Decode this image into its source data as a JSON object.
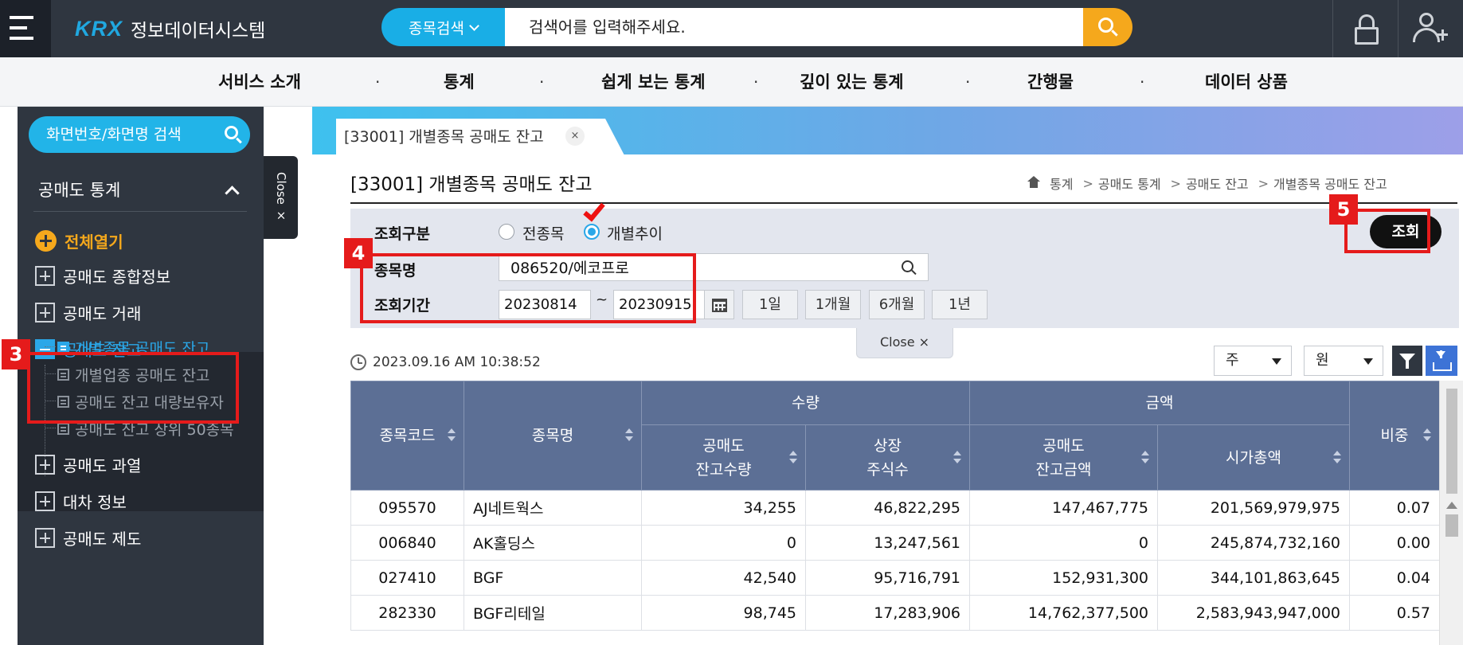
{
  "header": {
    "logo_brand": "KRX",
    "logo_name": "정보데이터시스템",
    "search_type": "종목검색",
    "search_placeholder": "검색어를 입력해주세요."
  },
  "gnb": {
    "items": [
      "서비스 소개",
      "통계",
      "쉽게 보는 통계",
      "깊이 있는 통계",
      "간행물",
      "데이터 상품"
    ],
    "separator": "·"
  },
  "sidebar": {
    "search_placeholder": "화면번호/화면명 검색",
    "category": "공매도 통계",
    "expand_all": "전체열기",
    "items": [
      {
        "label": "공매도 종합정보",
        "state": "collapsed"
      },
      {
        "label": "공매도 거래",
        "state": "collapsed"
      },
      {
        "label": "공매도 잔고",
        "state": "expanded"
      },
      {
        "label": "공매도 과열",
        "state": "collapsed"
      },
      {
        "label": "대차 정보",
        "state": "collapsed"
      },
      {
        "label": "공매도 제도",
        "state": "collapsed"
      }
    ],
    "sub_items": [
      {
        "label": "개별종목 공매도 잔고",
        "active": true
      },
      {
        "label": "개별업종 공매도 잔고",
        "active": false
      },
      {
        "label": "공매도 잔고 대량보유자",
        "active": false
      },
      {
        "label": "공매도 잔고 상위 50종목",
        "active": false
      }
    ],
    "close_label": "Close ×"
  },
  "tabs": [
    {
      "label": "[33001] 개별종목 공매도 잔고",
      "close": "×"
    }
  ],
  "page": {
    "title": "[33001] 개별종목 공매도 잔고",
    "breadcrumb": [
      "통계",
      "공매도 통계",
      "공매도 잔고",
      "개별종목 공매도 잔고"
    ],
    "breadcrumb_sep": ">"
  },
  "filters": {
    "query_type_label": "조회구분",
    "query_type_options": [
      "전종목",
      "개별추이"
    ],
    "query_type_selected": "개별추이",
    "stock_label": "종목명",
    "stock_value": "086520/에코프로",
    "period_label": "조회기간",
    "date_from": "20230814",
    "date_sep": "~",
    "date_to": "20230915",
    "period_buttons": [
      "1일",
      "1개월",
      "6개월",
      "1년"
    ],
    "query_button": "조회",
    "close_label": "Close ×"
  },
  "toolbar": {
    "timestamp": "2023.09.16 AM 10:38:52",
    "unit_share": "주",
    "unit_currency": "원"
  },
  "table": {
    "group_headers": {
      "quantity": "수량",
      "amount": "금액"
    },
    "headers": {
      "code": "종목코드",
      "name": "종목명",
      "short_qty_1": "공매도",
      "short_qty_2": "잔고수량",
      "listed_1": "상장",
      "listed_2": "주식수",
      "short_amt_1": "공매도",
      "short_amt_2": "잔고금액",
      "market_cap": "시가총액",
      "ratio": "비중"
    },
    "rows": [
      [
        "095570",
        "AJ네트웍스",
        "34,255",
        "46,822,295",
        "147,467,775",
        "201,569,979,975",
        "0.07"
      ],
      [
        "006840",
        "AK홀딩스",
        "0",
        "13,247,561",
        "0",
        "245,874,732,160",
        "0.00"
      ],
      [
        "027410",
        "BGF",
        "42,540",
        "95,716,791",
        "152,931,300",
        "344,101,863,645",
        "0.04"
      ],
      [
        "282330",
        "BGF리테일",
        "98,745",
        "17,283,906",
        "14,762,377,500",
        "2,583,943,947,000",
        "0.57"
      ]
    ]
  },
  "annotations": {
    "badge_3": "3",
    "badge_4": "4",
    "badge_5": "5"
  },
  "colors": {
    "brand_blue": "#20a8e0",
    "accent_orange": "#f5a81c",
    "header_bg": "#2f3640",
    "table_header": "#5c6f95",
    "annotation_red": "#e51b1b"
  }
}
